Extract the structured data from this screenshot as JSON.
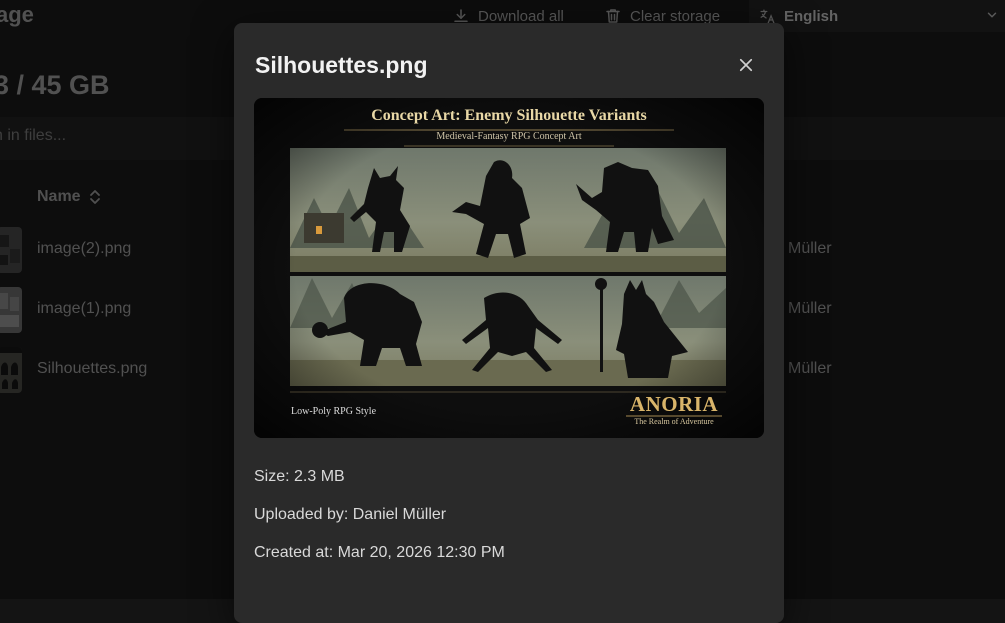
{
  "app": {
    "title": "age"
  },
  "toolbar": {
    "download_all": "Download all",
    "clear_storage": "Clear storage",
    "language": "English"
  },
  "storage": {
    "total": "3 / 45 GB"
  },
  "search": {
    "placeholder": "h in files..."
  },
  "table": {
    "name_header": "Name",
    "rows": [
      {
        "name": "image(2).png",
        "owner": "l Müller"
      },
      {
        "name": "image(1).png",
        "owner": "l Müller"
      },
      {
        "name": "Silhouettes.png",
        "owner": "l Müller"
      }
    ]
  },
  "modal": {
    "title": "Silhouettes.png",
    "preview": {
      "heading": "Concept Art: Enemy Silhouette Variants",
      "subheading": "Medieval-Fantasy RPG Concept Art",
      "style_label": "Low-Poly RPG Style",
      "logo_name": "ANORIA",
      "logo_tagline": "The Realm of Adventure"
    },
    "size": "Size: 2.3 MB",
    "uploaded_by": "Uploaded by: Daniel Müller",
    "created_at": "Created at: Mar 20, 2026 12:30 PM"
  },
  "icons": {
    "download": "download-icon",
    "clear": "trash-icon",
    "language": "translate-icon",
    "sort": "sort-icon",
    "close": "close-icon"
  },
  "colors": {
    "background": "#141414",
    "modal": "#2a2a2a",
    "preview_gold": "#d9b56a"
  }
}
